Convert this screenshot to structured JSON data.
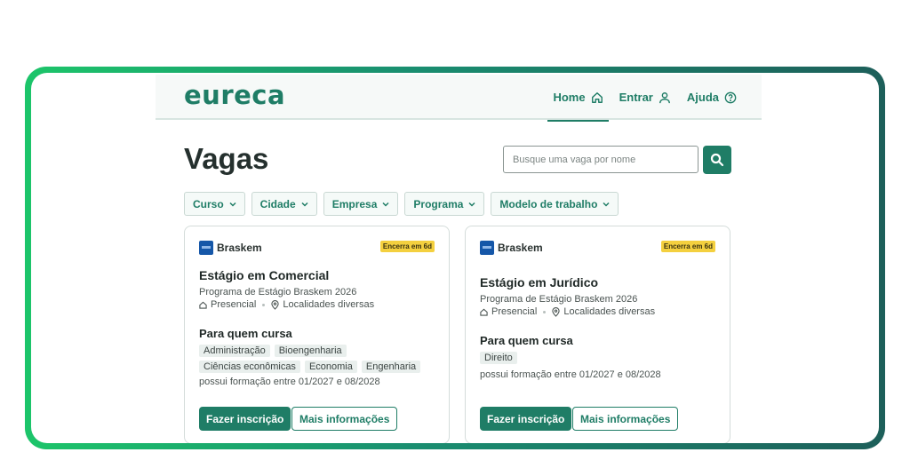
{
  "brand": {
    "logo": "eureca",
    "primary_color": "#1f7d66",
    "frame_gradient": [
      "#1cc56a",
      "#1d5f5a"
    ]
  },
  "nav": [
    {
      "label": "Home",
      "icon": "home-icon",
      "active": true
    },
    {
      "label": "Entrar",
      "icon": "user-icon",
      "active": false
    },
    {
      "label": "Ajuda",
      "icon": "help-icon",
      "active": false
    }
  ],
  "page_title": "Vagas",
  "search": {
    "placeholder": "Busque uma vaga por nome",
    "value": ""
  },
  "filters": [
    "Curso",
    "Cidade",
    "Empresa",
    "Programa",
    "Modelo de trabalho"
  ],
  "cards": [
    {
      "company": "Braskem",
      "badge": "Encerra em 6d",
      "title": "Estágio em Comercial",
      "program": "Programa de Estágio Braskem 2026",
      "mode": "Presencial",
      "location": "Localidades diversas",
      "section_title": "Para quem cursa",
      "courses": [
        "Administração",
        "Bioengenharia",
        "Ciências econômicas",
        "Economia",
        "Engenharia"
      ],
      "note": "possui formação entre 01/2027 e 08/2028",
      "apply_label": "Fazer inscrição",
      "more_label": "Mais informações"
    },
    {
      "company": "Braskem",
      "badge": "Encerra em 6d",
      "title": "Estágio em Jurídico",
      "program": "Programa de Estágio Braskem 2026",
      "mode": "Presencial",
      "location": "Localidades diversas",
      "section_title": "Para quem cursa",
      "courses": [
        "Direito"
      ],
      "note": "possui formação entre 01/2027 e 08/2028",
      "apply_label": "Fazer inscrição",
      "more_label": "Mais informações"
    }
  ]
}
